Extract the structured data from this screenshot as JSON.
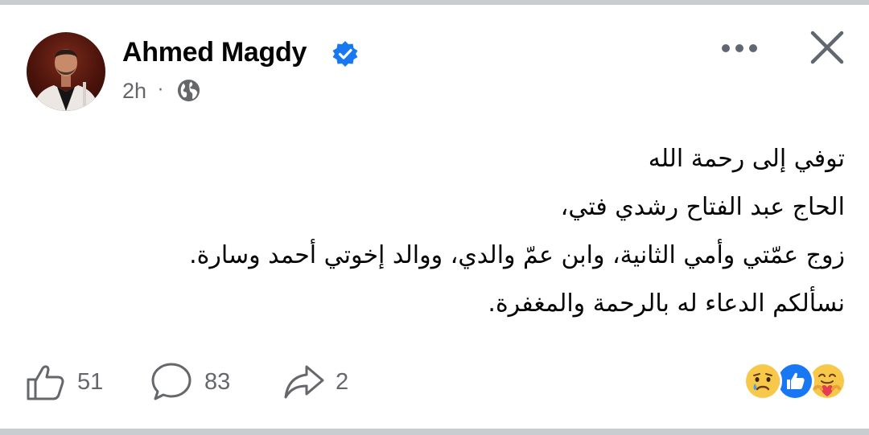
{
  "post": {
    "author": "Ahmed Magdy",
    "time": "2h",
    "separator": "·",
    "privacy_icon": "globe-icon",
    "verified": true,
    "accent_color": "#1877f2",
    "lines": [
      "توفي إلى رحمة الله",
      "الحاج عبد الفتاح رشدي فتي،",
      "زوج عمّتي وأمي الثانية، وابن عمّ والدي، ووالد إخوتي أحمد وسارة.",
      "نسألكم الدعاء له بالرحمة والمغفرة."
    ]
  },
  "header_actions": {
    "more_icon": "more-horizontal-icon",
    "close_icon": "close-icon"
  },
  "footer": {
    "like_count": "51",
    "comment_count": "83",
    "share_count": "2",
    "reactions": [
      "sad",
      "like",
      "care"
    ]
  }
}
